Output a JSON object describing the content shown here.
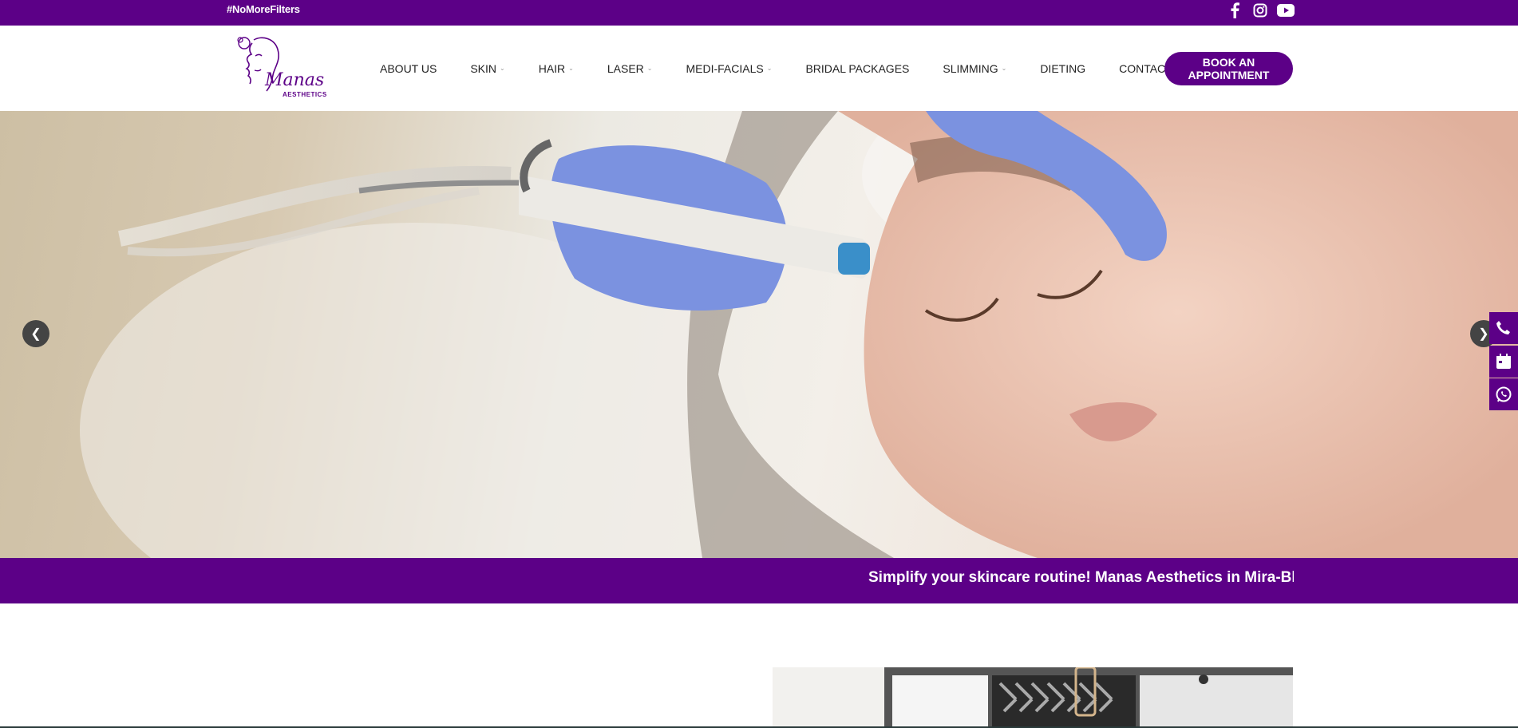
{
  "topbar": {
    "hashtag": "#NoMoreFilters",
    "social": [
      "facebook-icon",
      "instagram-icon",
      "youtube-icon"
    ]
  },
  "logo": {
    "brand": "Manas",
    "sub": "AESTHETICS"
  },
  "nav": {
    "items": [
      {
        "label": "ABOUT US",
        "dropdown": false
      },
      {
        "label": "SKIN",
        "dropdown": true
      },
      {
        "label": "HAIR",
        "dropdown": true
      },
      {
        "label": "LASER",
        "dropdown": true
      },
      {
        "label": "MEDI-FACIALS",
        "dropdown": true
      },
      {
        "label": "BRIDAL PACKAGES",
        "dropdown": false
      },
      {
        "label": "SLIMMING",
        "dropdown": true
      },
      {
        "label": "DIETING",
        "dropdown": false
      },
      {
        "label": "CONTACT US",
        "dropdown": false
      }
    ],
    "book_label_1": "BOOK AN",
    "book_label_2": "APPOINTMENT"
  },
  "hero": {
    "prev_icon": "chevron-left-icon",
    "next_icon": "chevron-right-icon"
  },
  "side_buttons": [
    "phone-icon",
    "calendar-icon",
    "whatsapp-icon"
  ],
  "marquee": {
    "text": "Simplify your skincare routine! Manas Aesthetics in Mira-Bhayander"
  },
  "colors": {
    "brand": "#5c0087",
    "white": "#ffffff"
  }
}
